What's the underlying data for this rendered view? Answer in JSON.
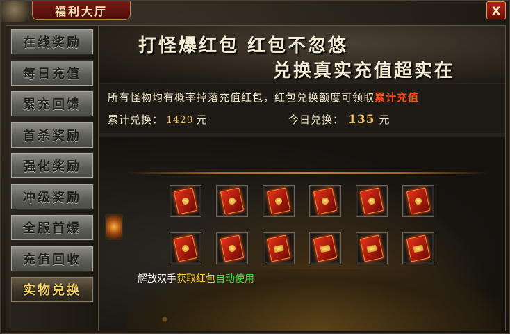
{
  "window": {
    "title": "福利大厅",
    "close_label": "X"
  },
  "sidebar": {
    "items": [
      {
        "label": "在线奖励",
        "active": false
      },
      {
        "label": "每日充值",
        "active": false
      },
      {
        "label": "累充回馈",
        "active": false
      },
      {
        "label": "首杀奖励",
        "active": false
      },
      {
        "label": "强化奖励",
        "active": false
      },
      {
        "label": "冲级奖励",
        "active": false
      },
      {
        "label": "全服首爆",
        "active": false
      },
      {
        "label": "充值回收",
        "active": false
      },
      {
        "label": "实物兑换",
        "active": true
      }
    ]
  },
  "banner": {
    "line1": "打怪爆红包  红包不忽悠",
    "line2": "兑换真实充值超实在"
  },
  "info": {
    "description": "所有怪物均有概率掉落充值红包，红包兑换额度可领取",
    "highlight": "累计充值",
    "total_label": "累计兑换：",
    "total_value": "1429",
    "total_unit": "元",
    "today_label": "今日兑换：",
    "today_value": "135",
    "today_unit": "元"
  },
  "items": [
    {
      "icon": "red-envelope-icon"
    },
    {
      "icon": "red-envelope-icon"
    },
    {
      "icon": "red-envelope-icon"
    },
    {
      "icon": "red-envelope-icon"
    },
    {
      "icon": "red-envelope-icon"
    },
    {
      "icon": "red-envelope-icon"
    },
    {
      "icon": "red-envelope-icon"
    },
    {
      "icon": "red-envelope-icon"
    },
    {
      "icon": "gold-red-envelope-icon"
    },
    {
      "icon": "gold-red-envelope-icon"
    },
    {
      "icon": "gold-red-envelope-icon"
    },
    {
      "icon": "gold-red-envelope-icon"
    }
  ],
  "footer": {
    "part1": "解放双手",
    "part2": "获取红包",
    "part3": "自动使用"
  },
  "colors": {
    "highlight": "#ff4a1a",
    "value": "#f0c060",
    "footer_yellow": "#ffd21e",
    "footer_green": "#3ee03e"
  }
}
